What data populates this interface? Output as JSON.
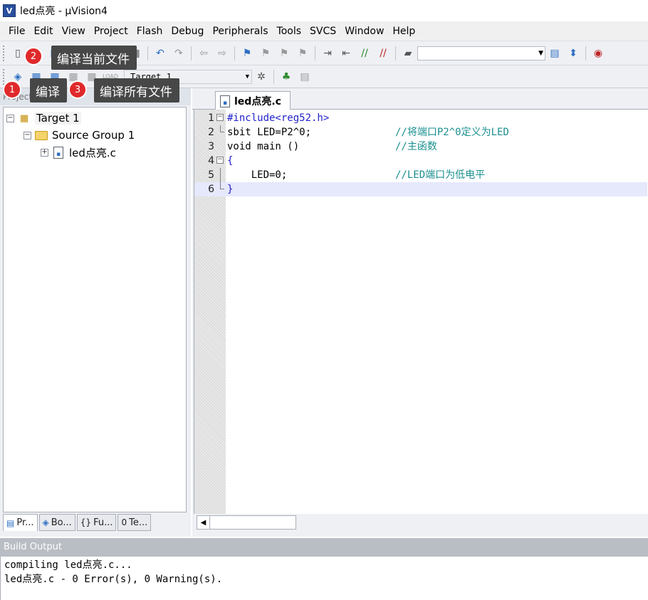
{
  "window": {
    "title": "led点亮  - μVision4",
    "app_icon": "V"
  },
  "menu": [
    "File",
    "Edit",
    "View",
    "Project",
    "Flash",
    "Debug",
    "Peripherals",
    "Tools",
    "SVCS",
    "Window",
    "Help"
  ],
  "toolbar2": {
    "target_label": "Target 1",
    "load_label": "LOAD"
  },
  "annotations": [
    {
      "number": "1",
      "text": "编译"
    },
    {
      "number": "2",
      "text": "编译当前文件"
    },
    {
      "number": "3",
      "text": "编译所有文件"
    }
  ],
  "project_panel": {
    "header": "Project",
    "tree": {
      "target": "Target 1",
      "group": "Source Group 1",
      "file": "led点亮.c"
    },
    "tabs": [
      "Pr...",
      "Bo...",
      "Fu...",
      "Te..."
    ]
  },
  "editor": {
    "tab_label": "led点亮.c",
    "lines": [
      {
        "num": "1",
        "code": "#include<reg52.h>",
        "comment": ""
      },
      {
        "num": "2",
        "code": "sbit LED=P2^0;",
        "comment": "//将端口P2^0定义为LED"
      },
      {
        "num": "3",
        "code": "void main ()",
        "comment": "//主函数"
      },
      {
        "num": "4",
        "code": "{",
        "comment": ""
      },
      {
        "num": "5",
        "code": "    LED=0;",
        "comment": "//LED端口为低电平"
      },
      {
        "num": "6",
        "code": "}",
        "comment": ""
      }
    ]
  },
  "build_output": {
    "header": "Build Output",
    "lines": [
      "compiling led点亮.c...",
      "led点亮.c - 0 Error(s), 0 Warning(s)."
    ]
  },
  "colors": {
    "comment": "#1b8f8f",
    "preprocessor": "#2222cc",
    "number": "#8c3ec0",
    "current_line": "#e6e8fc",
    "badge": "#e0292b",
    "tooltip_bg": "#474747"
  }
}
